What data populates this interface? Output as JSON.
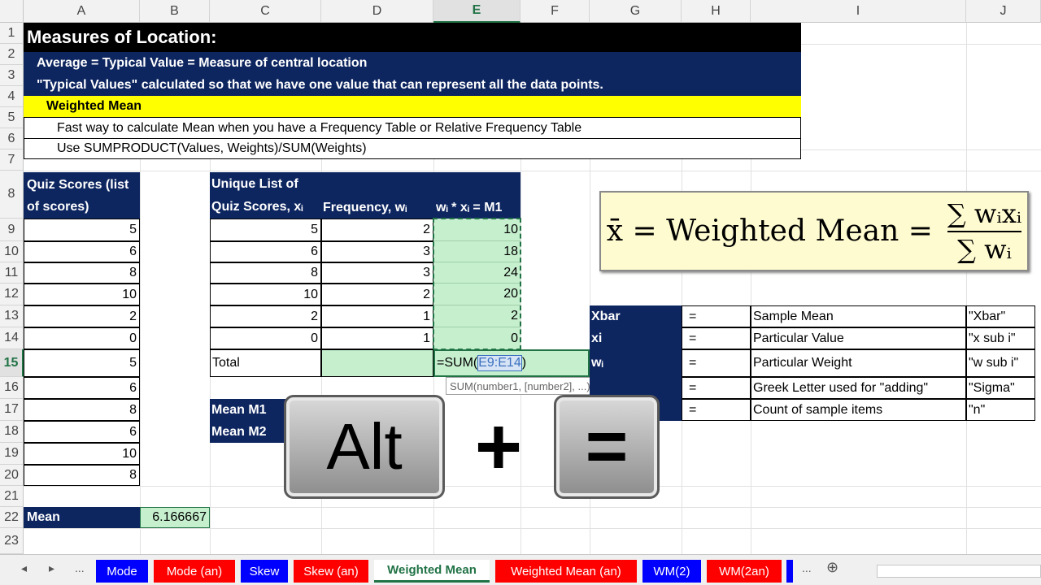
{
  "columns": [
    "A",
    "B",
    "C",
    "D",
    "E",
    "F",
    "G",
    "H",
    "I",
    "J"
  ],
  "rows": [
    "1",
    "2",
    "3",
    "4",
    "5",
    "6",
    "7",
    "8",
    "9",
    "10",
    "11",
    "12",
    "13",
    "14",
    "15",
    "16",
    "17",
    "18",
    "19",
    "20",
    "21",
    "22",
    "23"
  ],
  "title": "Measures of Location:",
  "line2": "Average = Typical Value = Measure of central location",
  "line3": "\"Typical Values\" calculated so that we have one value that can represent all the data points.",
  "line4": "Weighted Mean",
  "line5": "Fast way to calculate Mean when you have a Frequency Table or Relative Frequency Table",
  "line6": "Use SUMPRODUCT(Values, Weights)/SUM(Weights)",
  "quiz_header_1": "Quiz Scores (list",
  "quiz_header_2": "of scores)",
  "quiz_scores": [
    "5",
    "6",
    "8",
    "10",
    "2",
    "0",
    "5",
    "6",
    "8",
    "6",
    "10",
    "8"
  ],
  "unique_header_1": "Unique List of",
  "unique_header_2": "Quiz Scores, xᵢ",
  "freq_header": "Frequency, wᵢ",
  "product_header": "wᵢ * xᵢ = M1",
  "unique_values": [
    "5",
    "6",
    "8",
    "10",
    "2",
    "0"
  ],
  "frequencies": [
    "2",
    "3",
    "3",
    "2",
    "1",
    "1"
  ],
  "products": [
    "10",
    "18",
    "24",
    "20",
    "2",
    "0"
  ],
  "total_label": "Total",
  "formula_prefix": "=SUM(",
  "formula_ref": "E9:E14",
  "formula_suffix": ")",
  "tooltip": "SUM(number1, [number2], ...)",
  "mean_m1": "Mean M1",
  "mean_m2": "Mean M2",
  "mean_label": "Mean",
  "mean_value": "6.166667",
  "equation": {
    "lhs": "x̄ = Weighted Mean =",
    "numerator": "∑ wᵢxᵢ",
    "denominator": "∑ wᵢ"
  },
  "symbols": [
    {
      "sym": "Xbar",
      "eq": "=",
      "desc": "Sample Mean",
      "name": "\"Xbar\""
    },
    {
      "sym": "xi",
      "eq": "=",
      "desc": "Particular Value",
      "name": "\"x sub i\""
    },
    {
      "sym": "wᵢ",
      "eq": "=",
      "desc": "Particular Weight",
      "name": "\"w sub i\""
    },
    {
      "sym": "",
      "eq": "=",
      "desc": "Greek Letter used for \"adding\"",
      "name": "\"Sigma\""
    },
    {
      "sym": "",
      "eq": "=",
      "desc": "Count of sample items",
      "name": "\"n\""
    }
  ],
  "keys": {
    "alt": "Alt",
    "plus": "+",
    "equals": "="
  },
  "tabs": [
    {
      "label": "Mode",
      "color": "#0000ff"
    },
    {
      "label": "Mode (an)",
      "color": "#ff0000"
    },
    {
      "label": "Skew",
      "color": "#0000ff"
    },
    {
      "label": "Skew (an)",
      "color": "#ff0000"
    },
    {
      "label": "Weighted Mean",
      "color": "#ffffff"
    },
    {
      "label": "Weighted Mean (an)",
      "color": "#ff0000"
    },
    {
      "label": "WM(2)",
      "color": "#0000ff"
    },
    {
      "label": "WM(2an)",
      "color": "#ff0000"
    }
  ],
  "tab_nav": {
    "prev": "◂",
    "next": "▸",
    "more_left": "...",
    "more_right": "...",
    "add": "⊕"
  },
  "colors": {
    "navy": "#0e2660",
    "yellow": "#ffff00",
    "green_fill": "#c6efce",
    "excel_green": "#217346"
  }
}
